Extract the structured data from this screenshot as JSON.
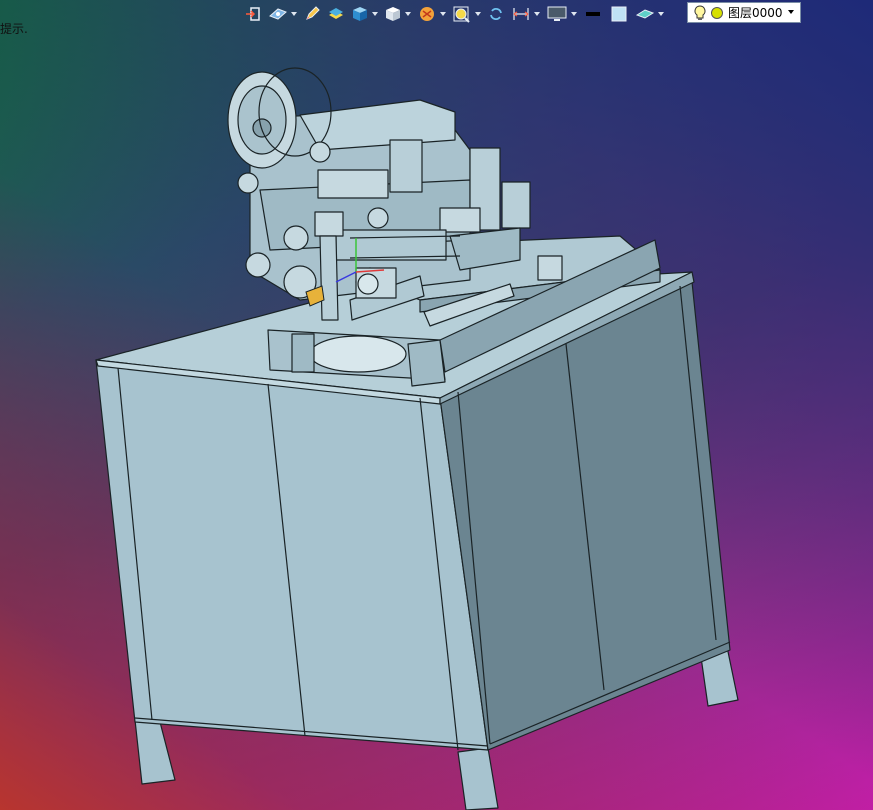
{
  "hint": {
    "text": "提示."
  },
  "toolbar": {
    "buttons": [
      {
        "icon": "exit-sketch-icon",
        "dropdown": false
      },
      {
        "icon": "view-orientation-icon",
        "dropdown": true
      },
      {
        "icon": "pencil-icon",
        "dropdown": false
      },
      {
        "icon": "layer-stack-icon",
        "dropdown": false
      },
      {
        "icon": "shaded-cube-icon",
        "dropdown": true
      },
      {
        "icon": "wire-cube-icon",
        "dropdown": true
      },
      {
        "icon": "section-view-icon",
        "dropdown": true
      },
      {
        "icon": "zoom-icon",
        "dropdown": true
      },
      {
        "icon": "rotate-icon",
        "dropdown": false
      },
      {
        "icon": "dimension-icon",
        "dropdown": true
      },
      {
        "icon": "display-monitor-icon",
        "dropdown": true
      },
      {
        "icon": "line-color-swatch-icon",
        "dropdown": false
      },
      {
        "icon": "fill-color-swatch-icon",
        "dropdown": false
      },
      {
        "icon": "surface-display-icon",
        "dropdown": true
      }
    ],
    "accent": "#dfe6f0"
  },
  "layer": {
    "label": "图层0000",
    "bulb_color": "#f5e400",
    "light_color": "#d6e000"
  },
  "model": {
    "body_color": "#a7c3cf",
    "side_color": "#6b8591",
    "top_color": "#b6cfd8",
    "edge_color": "#1a2326"
  }
}
